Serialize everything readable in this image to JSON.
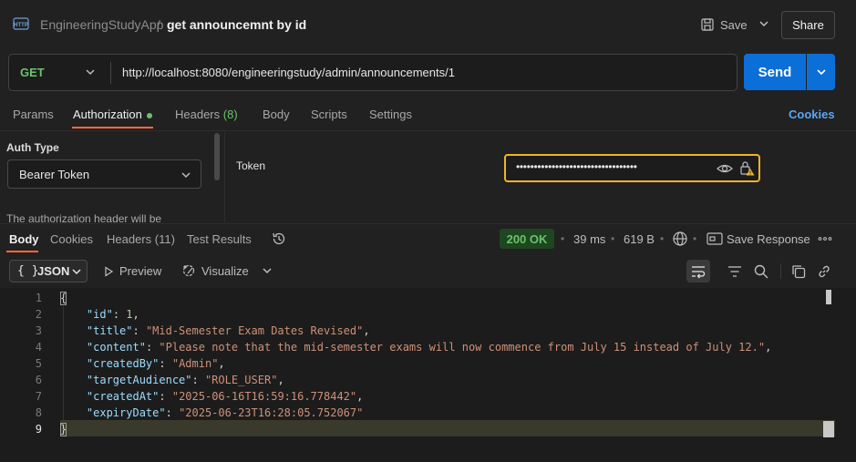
{
  "header": {
    "workspace": "EngineeringStudyApp",
    "separator": "/",
    "request_name": "get announcemnt by id",
    "save_label": "Save",
    "share_label": "Share"
  },
  "request": {
    "method": "GET",
    "url": "http://localhost:8080/engineeringstudy/admin/announcements/1",
    "send_label": "Send"
  },
  "request_tabs": {
    "params": "Params",
    "authorization": "Authorization",
    "headers": "Headers",
    "headers_count": "(8)",
    "body": "Body",
    "scripts": "Scripts",
    "settings": "Settings",
    "cookies": "Cookies"
  },
  "auth": {
    "type_label": "Auth Type",
    "type_value": "Bearer Token",
    "note": "The authorization header will be",
    "token_label": "Token",
    "token_masked": "••••••••••••••••••••••••••••••••••"
  },
  "response_tabs": {
    "body": "Body",
    "cookies": "Cookies",
    "headers": "Headers (11)",
    "test_results": "Test Results"
  },
  "response_meta": {
    "status": "200 OK",
    "time": "39 ms",
    "size": "619 B",
    "save_response": "Save Response"
  },
  "response_toolbar": {
    "format_braces": "{ }",
    "format": "JSON",
    "preview": "Preview",
    "visualize": "Visualize"
  },
  "code_lines": [
    {
      "n": "1",
      "text": "{"
    },
    {
      "n": "2",
      "key": "\"id\"",
      "value": "1",
      "vtype": "n",
      "trail": ","
    },
    {
      "n": "3",
      "key": "\"title\"",
      "value": "\"Mid-Semester Exam Dates Revised\"",
      "vtype": "s",
      "trail": ","
    },
    {
      "n": "4",
      "key": "\"content\"",
      "value": "\"Please note that the mid-semester exams will now commence from July 15 instead of July 12.\"",
      "vtype": "s",
      "trail": ","
    },
    {
      "n": "5",
      "key": "\"createdBy\"",
      "value": "\"Admin\"",
      "vtype": "s",
      "trail": ","
    },
    {
      "n": "6",
      "key": "\"targetAudience\"",
      "value": "\"ROLE_USER\"",
      "vtype": "s",
      "trail": ","
    },
    {
      "n": "7",
      "key": "\"createdAt\"",
      "value": "\"2025-06-16T16:59:16.778442\"",
      "vtype": "s",
      "trail": ","
    },
    {
      "n": "8",
      "key": "\"expiryDate\"",
      "value": "\"2025-06-23T16:28:05.752067\"",
      "vtype": "s",
      "trail": ""
    },
    {
      "n": "9",
      "text": "}"
    }
  ],
  "colors": {
    "accent_orange": "#ff6c37",
    "send_blue": "#0c6fd8",
    "get_green": "#6cc26c",
    "token_border": "#f0b429",
    "link_blue": "#5aa6f5"
  },
  "icons": [
    "http-icon",
    "save-icon",
    "chevron-down-icon",
    "eye-icon",
    "lock-warning-icon",
    "history-icon",
    "globe-icon",
    "save-response-icon",
    "more-icon",
    "play-icon",
    "visualize-icon",
    "wrap-lines-icon",
    "filter-icon",
    "search-icon",
    "copy-icon",
    "link-icon"
  ]
}
